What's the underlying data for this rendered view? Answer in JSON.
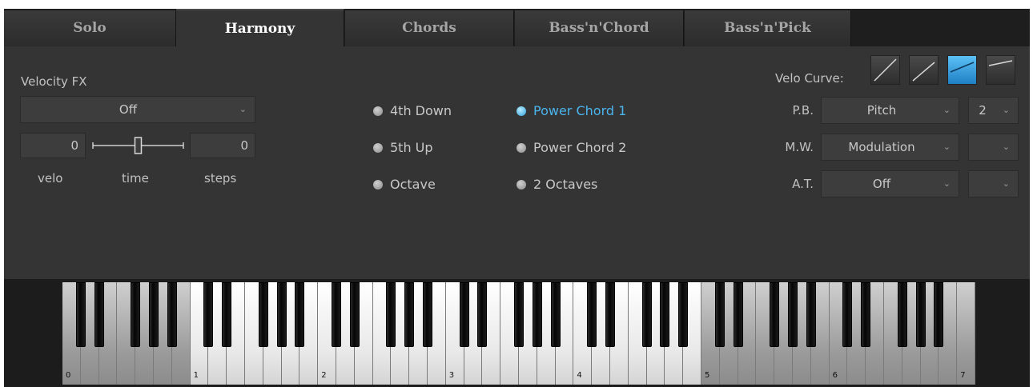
{
  "tabs": [
    {
      "label": "Solo",
      "active": false
    },
    {
      "label": "Harmony",
      "active": true
    },
    {
      "label": "Chords",
      "active": false
    },
    {
      "label": "Bass'n'Chord",
      "active": false
    },
    {
      "label": "Bass'n'Pick",
      "active": false
    }
  ],
  "velocity_fx": {
    "title": "Velocity FX",
    "mode_value": "Off",
    "velo_value": "0",
    "steps_value": "0",
    "velo_label": "velo",
    "time_label": "time",
    "steps_label": "steps",
    "time_slider_fraction": 0.5
  },
  "harmony": {
    "options": [
      {
        "label": "4th Down",
        "selected": false
      },
      {
        "label": "5th Up",
        "selected": false
      },
      {
        "label": "Octave",
        "selected": false
      },
      {
        "label": "Power Chord 1",
        "selected": true
      },
      {
        "label": "Power Chord 2",
        "selected": false
      },
      {
        "label": "2 Octaves",
        "selected": false
      }
    ]
  },
  "controllers": {
    "velo_curve_label": "Velo Curve:",
    "velo_curve_selected": 3,
    "pb_label": "P.B.",
    "pb_value": "Pitch",
    "pb_range": "2",
    "mw_label": "M.W.",
    "mw_value": "Modulation",
    "mw_range": "",
    "at_label": "A.T.",
    "at_value": "Off",
    "at_range": ""
  },
  "keyboard": {
    "octave_labels": [
      "0",
      "1",
      "2",
      "3",
      "4",
      "5",
      "6",
      "7"
    ]
  },
  "colors": {
    "accent": "#4ab4ee",
    "panel": "#343434"
  }
}
